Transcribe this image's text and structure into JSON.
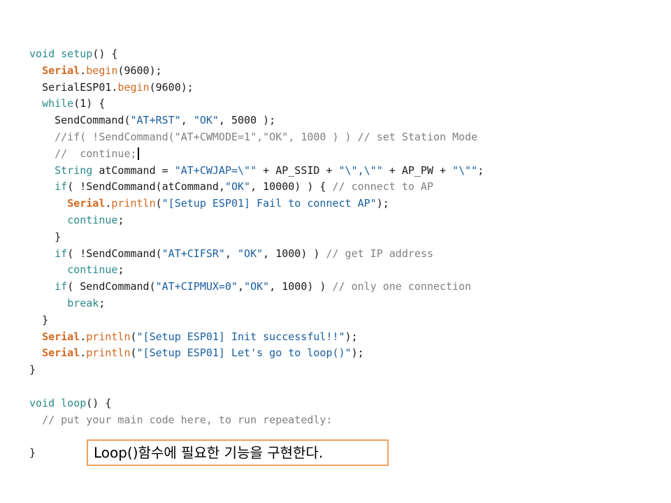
{
  "code": {
    "l1": {
      "kw": "void",
      "fn": "setup",
      "rest": "() {"
    },
    "l2": {
      "indent": "  ",
      "obj": "Serial",
      "dot": ".",
      "meth": "begin",
      "rest": "(9600);"
    },
    "l3": {
      "indent": "  ",
      "pre": "SerialESP01.",
      "meth": "begin",
      "rest": "(9600);"
    },
    "l4": {
      "indent": "  ",
      "kw": "while",
      "rest": "(1) {"
    },
    "l5": {
      "indent": "    ",
      "pre": "SendCommand(",
      "s1": "\"AT+RST\"",
      "mid": ", ",
      "s2": "\"OK\"",
      "rest": ", 5000 );"
    },
    "l6": {
      "indent": "    ",
      "cmt": "//if( !SendCommand(\"AT+CWMODE=1\",\"OK\", 1000 ) ) // set Station Mode"
    },
    "l7": {
      "indent": "    ",
      "cmt": "//  continue;"
    },
    "l8": {
      "indent": "    ",
      "kw": "String",
      "pre": " atCommand = ",
      "s1": "\"AT+CWJAP=\\\"\"",
      "mid": " + AP_SSID + ",
      "s2": "\"\\\",\\\"\"",
      "mid2": " + AP_PW + ",
      "s3": "\"\\\"\"",
      "rest": ";"
    },
    "l9": {
      "indent": "    ",
      "kw": "if",
      "pre": "( !SendCommand(atCommand,",
      "s1": "\"OK\"",
      "rest": ", 10000) ) { ",
      "cmt": "// connect to AP"
    },
    "l10": {
      "indent": "      ",
      "obj": "Serial",
      "dot": ".",
      "meth": "println",
      "pre": "(",
      "s1": "\"[Setup ESP01] Fail to connect AP\"",
      "rest": ");"
    },
    "l11": {
      "indent": "      ",
      "kw": "continue",
      "rest": ";"
    },
    "l12": {
      "indent": "    ",
      "rest": "}"
    },
    "l13": {
      "indent": "    ",
      "kw": "if",
      "pre": "( !SendCommand(",
      "s1": "\"AT+CIFSR\"",
      "mid": ", ",
      "s2": "\"OK\"",
      "rest": ", 1000) ) ",
      "cmt": "// get IP address"
    },
    "l14": {
      "indent": "      ",
      "kw": "continue",
      "rest": ";"
    },
    "l15": {
      "indent": "    ",
      "kw": "if",
      "pre": "( SendCommand(",
      "s1": "\"AT+CIPMUX=0\"",
      "mid": ",",
      "s2": "\"OK\"",
      "rest": ", 1000) ) ",
      "cmt": "// only one connection"
    },
    "l16": {
      "indent": "      ",
      "kw": "break",
      "rest": ";"
    },
    "l17": {
      "indent": "  ",
      "rest": "}"
    },
    "l18": {
      "indent": "  ",
      "obj": "Serial",
      "dot": ".",
      "meth": "println",
      "pre": "(",
      "s1": "\"[Setup ESP01] Init successful!!\"",
      "rest": ");"
    },
    "l19": {
      "indent": "  ",
      "obj": "Serial",
      "dot": ".",
      "meth": "println",
      "pre": "(",
      "s1": "\"[Setup ESP01] Let's go to loop()\"",
      "rest": ");"
    },
    "l20": {
      "rest": "}"
    },
    "l22": {
      "kw": "void",
      "fn": "loop",
      "rest": "() {"
    },
    "l23": {
      "indent": "  ",
      "cmt": "// put your main code here, to run repeatedly:"
    },
    "l25": {
      "rest": "}"
    }
  },
  "note": {
    "text": "Loop()함수에 필요한 기능을 구현한다."
  },
  "colors": {
    "keyword": "#2b8a8a",
    "object": "#d2691e",
    "string": "#1a5fa0",
    "comment": "#808080",
    "note_border": "#f0a060"
  }
}
